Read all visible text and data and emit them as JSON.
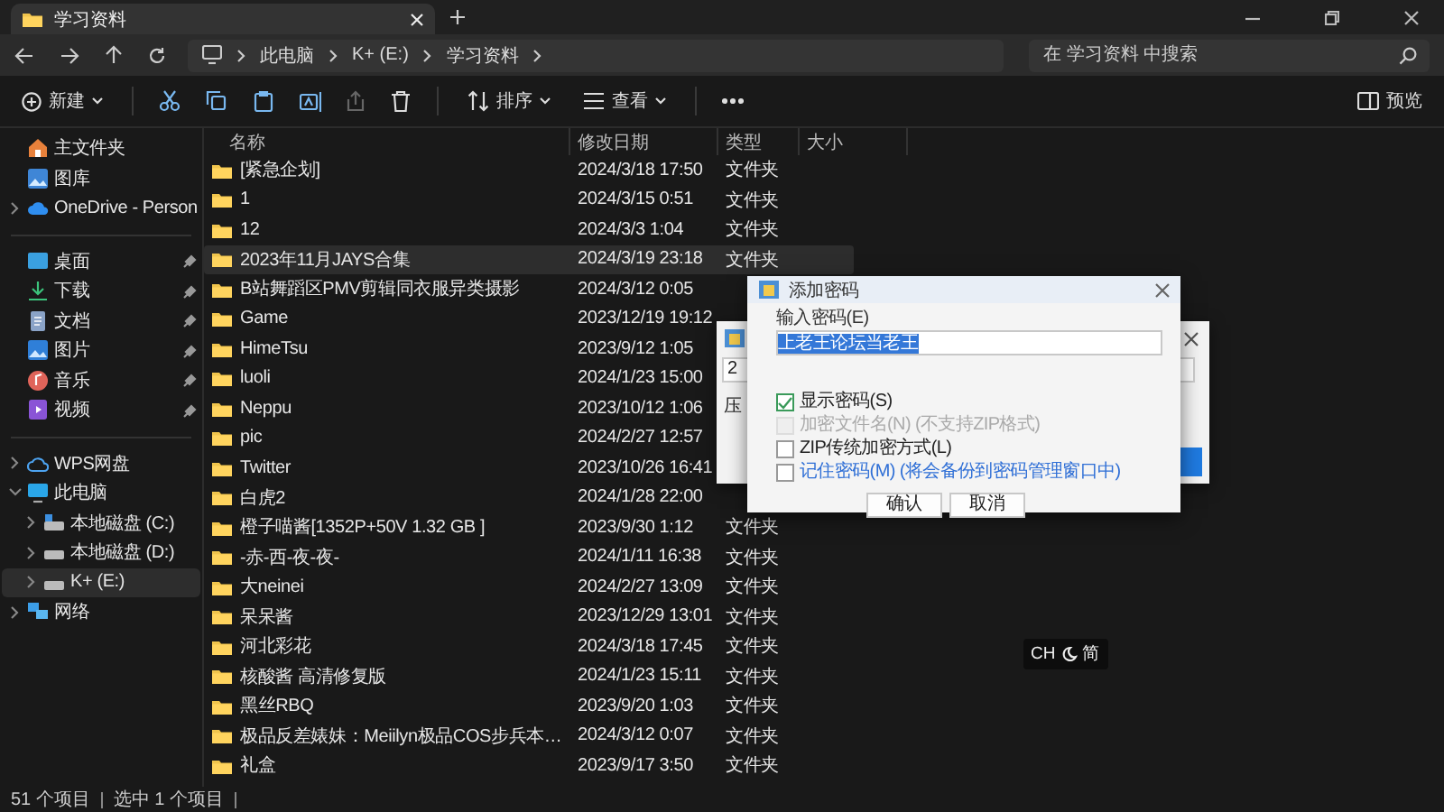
{
  "tabs": [
    {
      "title": "学习资料",
      "selected": true
    }
  ],
  "address": {
    "crumbs": [
      "此电脑",
      "K+ (E:)",
      "学习资料"
    ]
  },
  "search": {
    "placeholder": "在 学习资料 中搜索"
  },
  "toolbar": {
    "new_label": "新建",
    "sort_label": "排序",
    "view_label": "查看",
    "preview_label": "预览"
  },
  "sidebar": {
    "groups": [
      [
        {
          "label": "主文件夹",
          "selected": false
        },
        {
          "label": "图库",
          "selected": false
        },
        {
          "label": "OneDrive - Person",
          "selected": false,
          "expanded": false
        }
      ],
      [
        {
          "label": "桌面",
          "selected": false,
          "pinned": true
        },
        {
          "label": "下载",
          "selected": false,
          "pinned": true
        },
        {
          "label": "文档",
          "selected": false,
          "pinned": true
        },
        {
          "label": "图片",
          "selected": false,
          "pinned": true
        },
        {
          "label": "音乐",
          "selected": false,
          "pinned": true
        },
        {
          "label": "视频",
          "selected": false,
          "pinned": true
        }
      ],
      [
        {
          "label": "WPS网盘",
          "selected": false,
          "expanded": false
        },
        {
          "label": "此电脑",
          "selected": false,
          "expanded": true,
          "children": [
            {
              "label": "本地磁盘 (C:)",
              "selected": false,
              "expanded": false
            },
            {
              "label": "本地磁盘 (D:)",
              "selected": false,
              "expanded": false
            },
            {
              "label": "K+ (E:)",
              "selected": true,
              "expanded": false
            }
          ]
        },
        {
          "label": "网络",
          "selected": false,
          "expanded": false
        }
      ]
    ]
  },
  "table": {
    "columns": [
      "名称",
      "修改日期",
      "类型",
      "大小"
    ],
    "rows": [
      {
        "name": "[紧急企划]",
        "date": "2024/3/18 17:50",
        "type": "文件夹",
        "selected": false
      },
      {
        "name": "1",
        "date": "2024/3/15 0:51",
        "type": "文件夹",
        "selected": false
      },
      {
        "name": "12",
        "date": "2024/3/3 1:04",
        "type": "文件夹",
        "selected": false
      },
      {
        "name": "2023年11月JAYS合集",
        "date": "2024/3/19 23:18",
        "type": "文件夹",
        "selected": true
      },
      {
        "name": "B站舞蹈区PMV剪辑同衣服异类摄影",
        "date": "2024/3/12 0:05",
        "selected": false
      },
      {
        "name": "Game",
        "date": "2023/12/19 19:12",
        "selected": false
      },
      {
        "name": "HimeTsu",
        "date": "2023/9/12 1:05",
        "selected": false
      },
      {
        "name": "luoli",
        "date": "2024/1/23 15:00",
        "selected": false
      },
      {
        "name": "Neppu",
        "date": "2023/10/12 1:06",
        "selected": false
      },
      {
        "name": "pic",
        "date": "2024/2/27 12:57",
        "selected": false
      },
      {
        "name": "Twitter",
        "date": "2023/10/26 16:41",
        "selected": false
      },
      {
        "name": "白虎2",
        "date": "2024/1/28 22:00",
        "selected": false
      },
      {
        "name": "橙子喵酱[1352P+50V 1.32 GB ]",
        "date": "2023/9/30 1:12",
        "type": "文件夹",
        "selected": false
      },
      {
        "name": "-赤-西-夜-夜-",
        "date": "2024/1/11 16:38",
        "type": "文件夹",
        "selected": false
      },
      {
        "name": "大neinei",
        "date": "2024/2/27 13:09",
        "type": "文件夹",
        "selected": false
      },
      {
        "name": "呆呆酱",
        "date": "2023/12/29 13:01",
        "type": "文件夹",
        "selected": false
      },
      {
        "name": "河北彩花",
        "date": "2024/3/18 17:45",
        "type": "文件夹",
        "selected": false
      },
      {
        "name": "核酸酱 高清修复版",
        "date": "2024/1/23 15:11",
        "type": "文件夹",
        "selected": false
      },
      {
        "name": "黑丝RBQ",
        "date": "2023/9/20 1:03",
        "type": "文件夹",
        "selected": false
      },
      {
        "name": "极品反差婊妹：Meiilyn极品COS步兵本…",
        "date": "2024/3/12 0:07",
        "type": "文件夹",
        "selected": false
      },
      {
        "name": "礼盒",
        "date": "2023/9/17 3:50",
        "type": "文件夹",
        "selected": false
      }
    ]
  },
  "back_dialog": {
    "field_text": "2",
    "label": "压"
  },
  "dialog": {
    "title": "添加密码",
    "field_label": "输入密码(E)",
    "value": "上老王论坛当老王",
    "options": [
      {
        "label": "显示密码(S)",
        "checked": true,
        "disabled": false,
        "kind": "plain"
      },
      {
        "label": "加密文件名(N) (不支持ZIP格式)",
        "checked": false,
        "disabled": true,
        "kind": "plain"
      },
      {
        "label": "ZIP传统加密方式(L)",
        "checked": false,
        "disabled": false,
        "kind": "plain"
      },
      {
        "label": "记住密码(M) (将会备份到密码管理窗口中)",
        "checked": false,
        "disabled": false,
        "kind": "accent"
      }
    ],
    "buttons": [
      "确认",
      "取消"
    ]
  },
  "ime": {
    "lang": "CH",
    "mode": "简"
  },
  "status_bar": [
    "51 个项目",
    "选中 1 个项目"
  ]
}
